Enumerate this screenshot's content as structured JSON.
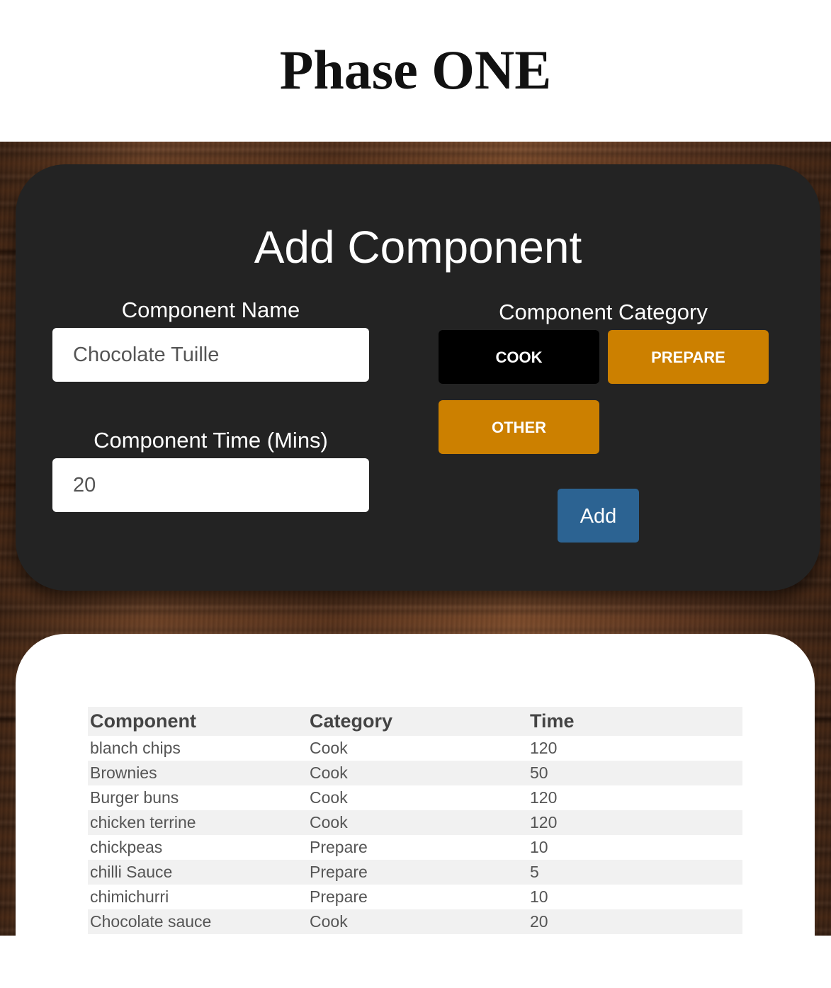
{
  "header": {
    "title": "Phase ONE"
  },
  "form": {
    "title": "Add Component",
    "name_label": "Component Name",
    "name_value": "Chocolate Tuille",
    "time_label": "Component Time (Mins)",
    "time_value": "20",
    "category_label": "Component Category",
    "categories": [
      {
        "label": "COOK",
        "selected": true
      },
      {
        "label": "PREPARE",
        "selected": false
      },
      {
        "label": "OTHER",
        "selected": false
      }
    ],
    "add_label": "Add"
  },
  "colors": {
    "card_dark": "#232323",
    "category_selected": "#000000",
    "category_unselected": "#cc8000",
    "add_button": "#2c6392"
  },
  "table": {
    "headers": [
      "Component",
      "Category",
      "Time"
    ],
    "rows": [
      [
        "blanch chips",
        "Cook",
        "120"
      ],
      [
        "Brownies",
        "Cook",
        "50"
      ],
      [
        "Burger buns",
        "Cook",
        "120"
      ],
      [
        "chicken terrine",
        "Cook",
        "120"
      ],
      [
        "chickpeas",
        "Prepare",
        "10"
      ],
      [
        "chilli Sauce",
        "Prepare",
        "5"
      ],
      [
        "chimichurri",
        "Prepare",
        "10"
      ],
      [
        "Chocolate sauce",
        "Cook",
        "20"
      ]
    ]
  }
}
